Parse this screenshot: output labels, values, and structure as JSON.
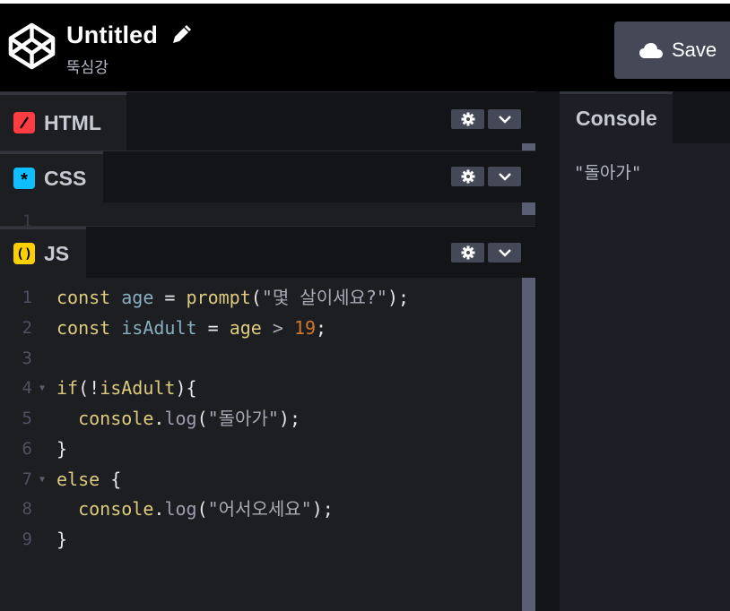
{
  "header": {
    "title": "Untitled",
    "subtitle": "뚝심강",
    "save_label": "Save",
    "icons": [
      "codepen-logo-icon",
      "pencil-icon",
      "cloud-icon"
    ]
  },
  "panes": {
    "html": {
      "label": "HTML",
      "badge": "/",
      "badge_color": "#ff3c41"
    },
    "css": {
      "label": "CSS",
      "badge": "*",
      "badge_color": "#0ebeff",
      "line_number": "1"
    },
    "js": {
      "label": "JS",
      "badge": "()",
      "badge_color": "#fcd000"
    }
  },
  "code": {
    "line_numbers": [
      "1",
      "2",
      "3",
      "4",
      "5",
      "6",
      "7",
      "8",
      "9"
    ],
    "lines": [
      [
        [
          "kw",
          "const"
        ],
        [
          "plain",
          " "
        ],
        [
          "var",
          "age"
        ],
        [
          "plain",
          " = "
        ],
        [
          "fn",
          "prompt"
        ],
        [
          "plain",
          "("
        ],
        [
          "str",
          "\"몇 살이세요?\""
        ],
        [
          "plain",
          ");"
        ]
      ],
      [
        [
          "kw",
          "const"
        ],
        [
          "plain",
          " "
        ],
        [
          "var",
          "isAdult"
        ],
        [
          "plain",
          " = "
        ],
        [
          "fn",
          "age"
        ],
        [
          "plain",
          " "
        ],
        [
          "op",
          ">"
        ],
        [
          "plain",
          " "
        ],
        [
          "num",
          "19"
        ],
        [
          "plain",
          ";"
        ]
      ],
      [],
      [
        [
          "kw",
          "if"
        ],
        [
          "plain",
          "(!"
        ],
        [
          "fn",
          "isAdult"
        ],
        [
          "plain",
          "){"
        ]
      ],
      [
        [
          "plain",
          "  "
        ],
        [
          "prop",
          "console"
        ],
        [
          "plain",
          "."
        ],
        [
          "meth",
          "log"
        ],
        [
          "plain",
          "("
        ],
        [
          "str",
          "\"돌아가\""
        ],
        [
          "plain",
          ");"
        ]
      ],
      [
        [
          "plain",
          "}"
        ]
      ],
      [
        [
          "kw",
          "else"
        ],
        [
          "plain",
          " {"
        ]
      ],
      [
        [
          "plain",
          "  "
        ],
        [
          "prop",
          "console"
        ],
        [
          "plain",
          "."
        ],
        [
          "meth",
          "log"
        ],
        [
          "plain",
          "("
        ],
        [
          "str",
          "\"어서오세요\""
        ],
        [
          "plain",
          ");"
        ]
      ],
      [
        [
          "plain",
          "}"
        ]
      ]
    ]
  },
  "console": {
    "label": "Console",
    "output": "\"돌아가\""
  }
}
